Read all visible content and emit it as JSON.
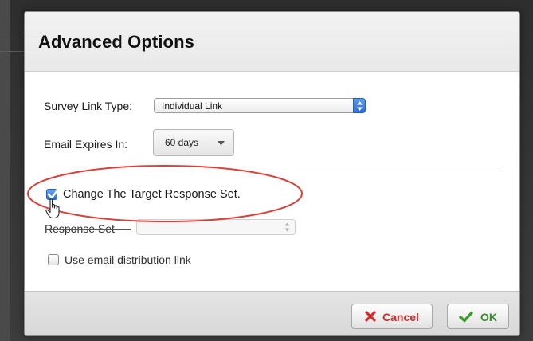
{
  "dialog": {
    "title": "Advanced Options"
  },
  "survey_link_type": {
    "label": "Survey Link Type:",
    "value": "Individual Link"
  },
  "email_expires": {
    "label": "Email Expires In:",
    "value": "60 days"
  },
  "change_target": {
    "label": "Change The Target Response Set.",
    "checked": true
  },
  "response_set": {
    "label": "Response Set",
    "value": ""
  },
  "use_email_link": {
    "label": "Use email distribution link",
    "checked": false
  },
  "footer": {
    "cancel_label": "Cancel",
    "ok_label": "OK"
  },
  "colors": {
    "highlight_ellipse": "#d9413a",
    "cancel_icon": "#d22b2b",
    "ok_icon": "#3a9a2a",
    "checkbox_checked": "#2d6fd5"
  },
  "icons": {
    "cancel": "x-icon",
    "ok": "checkmark-icon",
    "cursor": "hand-pointer-icon"
  }
}
